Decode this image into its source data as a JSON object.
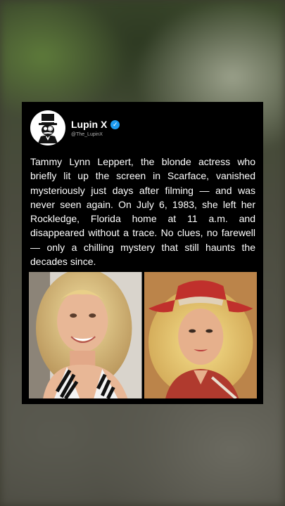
{
  "account": {
    "name": "Lupin X",
    "handle": "@The_LupinX",
    "verified": true,
    "avatar_icon": "monocle-gentleman-logo-icon"
  },
  "post": {
    "text": "Tammy Lynn Leppert, the blonde actress who briefly lit up the screen in Scarface, vanished mysteriously just days after filming — and was never seen again. On July 6, 1983, she left her Rockledge, Florida home at 11 a.m. and disappeared without a trace. No clues, no farewell — only a chilling mystery that still haunts the decades since."
  },
  "photos": [
    {
      "subject": "smiling blonde woman in zebra-print top"
    },
    {
      "subject": "blonde woman in red cowboy hat"
    }
  ],
  "colors": {
    "card_background": "#000000",
    "verified_badge": "#1d9bf0",
    "text": "#ffffff",
    "handle": "#b0b0b0"
  }
}
